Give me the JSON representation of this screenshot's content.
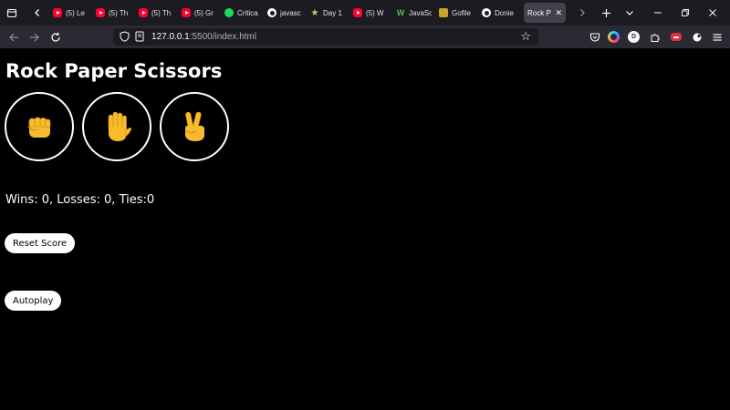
{
  "browser": {
    "tabs": [
      {
        "title": "(5) Le",
        "favicon": "youtube-icon"
      },
      {
        "title": "(5) Th",
        "favicon": "youtube-icon"
      },
      {
        "title": "(5) Th",
        "favicon": "youtube-icon"
      },
      {
        "title": "(5) Gr",
        "favicon": "youtube-icon"
      },
      {
        "title": "Critica",
        "favicon": "spotify-icon"
      },
      {
        "title": "javasc",
        "favicon": "github-icon"
      },
      {
        "title": "Day 1",
        "favicon": "star-icon"
      },
      {
        "title": "(5) W",
        "favicon": "youtube-icon"
      },
      {
        "title": "JavaSc",
        "favicon": "w-icon"
      },
      {
        "title": "Gofile",
        "favicon": "gofile-icon"
      },
      {
        "title": "Donie",
        "favicon": "github-icon"
      }
    ],
    "active_tab": {
      "title": "Rock Pa"
    },
    "address": {
      "host": "127.0.0.1",
      "rest": ":5500/index.html"
    },
    "extension_badge": "D"
  },
  "page": {
    "title": "Rock Paper Scissors",
    "moves": [
      {
        "name": "rock",
        "emoji": "fist"
      },
      {
        "name": "paper",
        "emoji": "raised-hand"
      },
      {
        "name": "scissors",
        "emoji": "victory-hand"
      }
    ],
    "score_text": "Wins: 0, Losses: 0, Ties:0",
    "reset_label": "Reset Score",
    "autoplay_label": "Autoplay"
  },
  "colors": {
    "page_bg": "#000000",
    "emoji_yellow": "#f7bb2d",
    "tabbar_bg": "#1c1b22",
    "navbar_bg": "#2b2a33"
  }
}
